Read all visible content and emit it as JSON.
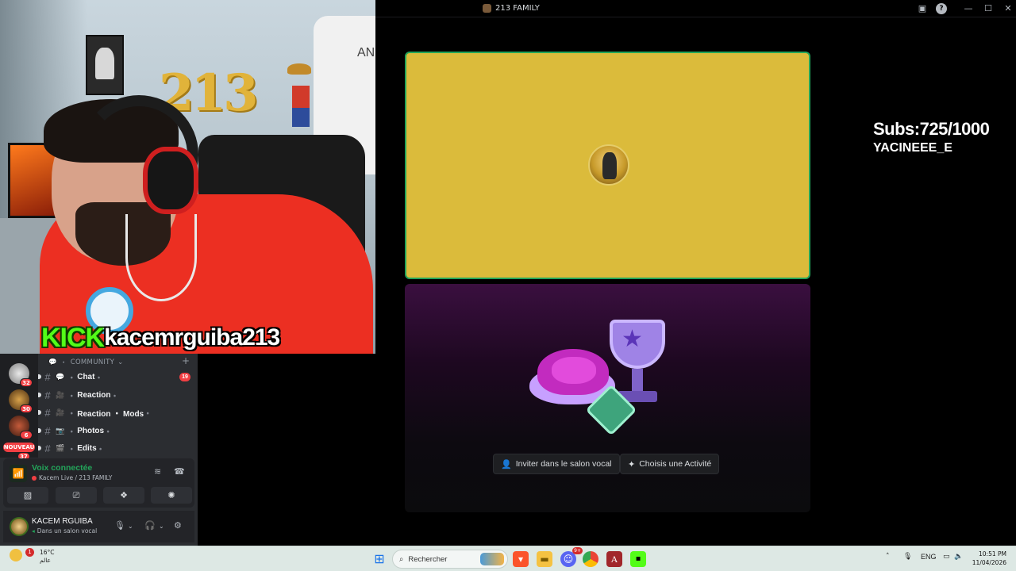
{
  "webcam": {
    "balloon_text": "213",
    "jersey_text": "AN",
    "overlay_kick": "KICK",
    "overlay_user": "kacemrguiba213"
  },
  "window": {
    "title": "213 FAMILY"
  },
  "stream": {
    "subs_line": "Subs:725/1000",
    "name_line": "YACINEEE_E"
  },
  "activity": {
    "invite_label": "Inviter dans le salon vocal",
    "activity_label": "Choisis une Activité"
  },
  "guilds": {
    "badges": [
      "32",
      "30",
      "6",
      "37"
    ],
    "new_label": "NOUVEAU"
  },
  "channels": {
    "category": "COMMUNITY",
    "items": [
      {
        "name": "Chat",
        "emoji": "💬",
        "unread": "19"
      },
      {
        "name": "Reaction",
        "emoji": "🎥",
        "unread": ""
      },
      {
        "name": "Reaction ・ Mods",
        "emoji": "🎥",
        "unread": ""
      },
      {
        "name": "Photos",
        "emoji": "📷",
        "unread": ""
      },
      {
        "name": "Edits",
        "emoji": "🎬",
        "unread": ""
      }
    ]
  },
  "voice": {
    "status": "Voix connectée",
    "location": "Kacem Live / 213 FAMILY"
  },
  "user": {
    "name": "KACEM RGUIBA",
    "status": "Dans un salon vocal"
  },
  "taskbar": {
    "weather_temp": "16°C",
    "weather_desc": "عالم",
    "weather_badge": "1",
    "search_placeholder": "Rechercher",
    "discord_badge": "9+",
    "lang": "ENG",
    "time": "10:51 PM",
    "date": "11/04/2026"
  },
  "colors": {
    "accent_green": "#23a55a",
    "kick_green": "#53fc18",
    "tile_yellow": "#dbbb3b",
    "badge_red": "#f23f43"
  }
}
